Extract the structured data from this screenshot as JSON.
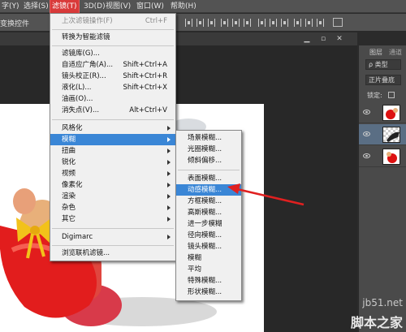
{
  "menubar": {
    "items": [
      {
        "label": "字(Y)"
      },
      {
        "label": "选择(S)"
      },
      {
        "label": "滤镜(T)"
      },
      {
        "label": "3D(D)"
      },
      {
        "label": "视图(V)"
      },
      {
        "label": "窗口(W)"
      },
      {
        "label": "帮助(H)"
      }
    ]
  },
  "options_bar": {
    "label": "变换控件"
  },
  "filter_menu": {
    "items": [
      {
        "label": "上次滤镜操作(F)",
        "shortcut": "Ctrl+F"
      },
      {
        "label": "转换为智能滤镜",
        "shortcut": ""
      },
      {
        "label": "滤镜库(G)...",
        "shortcut": ""
      },
      {
        "label": "自适应广角(A)...",
        "shortcut": "Shift+Ctrl+A"
      },
      {
        "label": "镜头校正(R)...",
        "shortcut": "Shift+Ctrl+R"
      },
      {
        "label": "液化(L)...",
        "shortcut": "Shift+Ctrl+X"
      },
      {
        "label": "油画(O)...",
        "shortcut": ""
      },
      {
        "label": "消失点(V)...",
        "shortcut": "Alt+Ctrl+V"
      },
      {
        "label": "风格化",
        "shortcut": ""
      },
      {
        "label": "模糊",
        "shortcut": ""
      },
      {
        "label": "扭曲",
        "shortcut": ""
      },
      {
        "label": "锐化",
        "shortcut": ""
      },
      {
        "label": "视频",
        "shortcut": ""
      },
      {
        "label": "像素化",
        "shortcut": ""
      },
      {
        "label": "渲染",
        "shortcut": ""
      },
      {
        "label": "杂色",
        "shortcut": ""
      },
      {
        "label": "其它",
        "shortcut": ""
      },
      {
        "label": "Digimarc",
        "shortcut": ""
      },
      {
        "label": "浏览联机滤镜...",
        "shortcut": ""
      }
    ]
  },
  "blur_submenu": {
    "items": [
      {
        "label": "场景模糊..."
      },
      {
        "label": "光圈模糊..."
      },
      {
        "label": "倾斜偏移..."
      },
      {
        "label": "表面模糊..."
      },
      {
        "label": "动感模糊..."
      },
      {
        "label": "方框模糊..."
      },
      {
        "label": "高斯模糊..."
      },
      {
        "label": "进一步模糊"
      },
      {
        "label": "径向模糊..."
      },
      {
        "label": "镜头模糊..."
      },
      {
        "label": "模糊"
      },
      {
        "label": "平均"
      },
      {
        "label": "特殊模糊..."
      },
      {
        "label": "形状模糊..."
      }
    ]
  },
  "layers_panel": {
    "tabs": [
      {
        "label": "图层"
      },
      {
        "label": "通道"
      }
    ],
    "kind_filter": "ρ 类型",
    "blend_mode": "正片叠底",
    "lock_label": "锁定:"
  },
  "watermark": {
    "domain": "jb51.net",
    "site_name": "脚本之家"
  },
  "colors": {
    "accent_red": "#d93a3a",
    "highlight_blue": "#3a86d6",
    "arrow_red": "#e02020"
  }
}
